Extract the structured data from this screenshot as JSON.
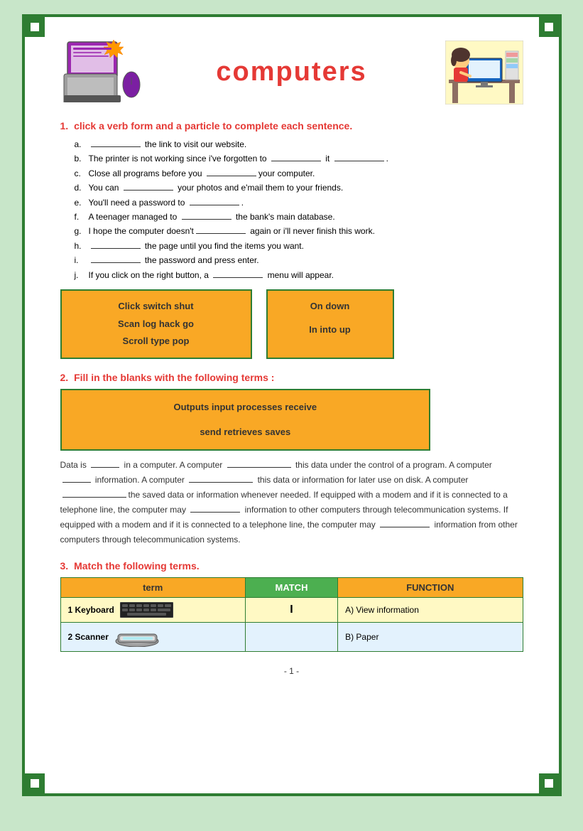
{
  "page": {
    "title": "computers",
    "page_number": "- 1 -"
  },
  "section1": {
    "label": "1.",
    "instruction": "click a verb form and a particle to complete each sentence.",
    "items": [
      {
        "letter": "a.",
        "text": "________ the link to visit our website."
      },
      {
        "letter": "b.",
        "text": "The printer is not working since i've forgotten to ________ it ________."
      },
      {
        "letter": "c.",
        "text": "Close all programs before you ________your computer."
      },
      {
        "letter": "d.",
        "text": "You can ________ your photos and e'mail them to your friends."
      },
      {
        "letter": "e.",
        "text": "You'll need a password to ________."
      },
      {
        "letter": "f.",
        "text": "A teenager managed to ________ the bank's main database."
      },
      {
        "letter": "g.",
        "text": "I hope the computer doesn't________ again or i'll never finish this work."
      },
      {
        "letter": "h.",
        "text": "________ the page until you find the items you want."
      },
      {
        "letter": "i.",
        "text": "________ the password and press enter."
      },
      {
        "letter": "j.",
        "text": "If you click on the right button, a ________ menu will appear."
      }
    ],
    "wordbox_left": {
      "row1": "Click    switch    shut",
      "row2": "Scan   log   hack   go",
      "row3": "Scroll    type    pop"
    },
    "wordbox_right": {
      "row1": "On    down",
      "row2": "In    into    up"
    }
  },
  "section2": {
    "label": "2.",
    "instruction": "Fill in the blanks with the following terms :",
    "wordbox": {
      "row1": "Outputs    input    processes    receive",
      "row2": "send    retrieves    saves"
    },
    "fill_text": "Data is ______ in a computer. A computer __________ this data under the control of a program. A computer ______ information. A computer __________ this data or information for later use on disk. A computer ____________the saved data or information whenever needed. If equipped with a modem and if it is connected to a telephone line, the computer may ________ information to other computers through telecommunication systems. If equipped with a modem and if it is connected to a telephone line, the computer may _________ information from other computers through telecommunication systems."
  },
  "section3": {
    "label": "3.",
    "instruction": "Match the following terms.",
    "table": {
      "headers": [
        "term",
        "MATCH",
        "FUNCTION"
      ],
      "rows": [
        {
          "term": "1 Keyboard",
          "match": "I",
          "function": "A) View information"
        },
        {
          "term": "2 Scanner",
          "match": "",
          "function": "B) Paper"
        }
      ]
    }
  }
}
